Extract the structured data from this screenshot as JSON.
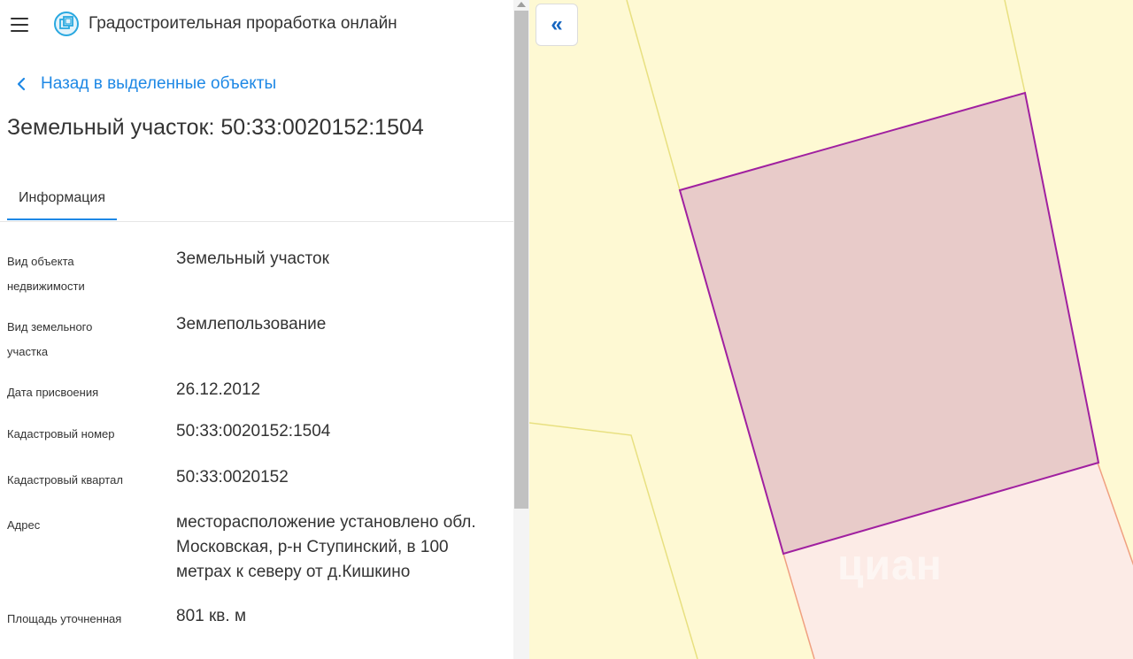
{
  "header": {
    "app_title": "Градостроительная проработка онлайн",
    "menu_icon": "hamburger-icon",
    "logo_icon": "app-logo-icon"
  },
  "nav": {
    "back_label": "Назад в выделенные объекты",
    "back_icon": "chevron-left-icon"
  },
  "object": {
    "title": "Земельный участок: 50:33:0020152:1504"
  },
  "tabs": [
    {
      "label": "Информация",
      "active": true
    }
  ],
  "details": [
    {
      "label": "Вид объекта недвижимости",
      "value": "Земельный участок"
    },
    {
      "label": "Вид земельного участка",
      "value": "Землепользование"
    },
    {
      "label": "Дата присвоения",
      "value": "26.12.2012"
    },
    {
      "label": "Кадастровый номер",
      "value": "50:33:0020152:1504"
    },
    {
      "label": "Кадастровый квартал",
      "value": "50:33:0020152"
    },
    {
      "label": "Адрес",
      "value": "месторасположение установлено обл. Московская, р-н Ступинский, в 100 метрах к северу от д.Кишкино"
    },
    {
      "label": "Площадь уточненная",
      "value": "801 кв. м"
    }
  ],
  "map": {
    "collapse_label": "«",
    "collapse_icon": "double-chevron-left-icon",
    "watermark": "циан",
    "colors": {
      "background": "#fef9d3",
      "selected_parcel_fill": "#e8cbc9",
      "selected_parcel_stroke": "#a020a0",
      "neighbor_parcel_fill": "#fcebe6",
      "neighbor_parcel_stroke": "#f0a080",
      "boundary_line": "#e8e080"
    }
  },
  "colors": {
    "accent": "#1e88e5",
    "text": "#333333"
  }
}
